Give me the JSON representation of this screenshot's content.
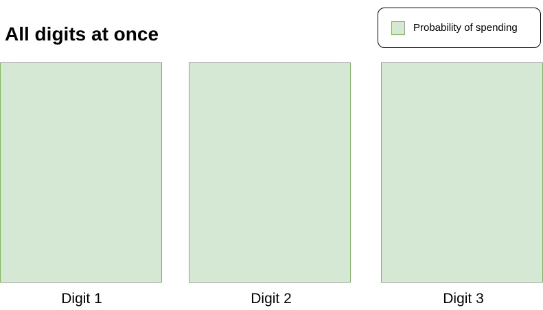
{
  "title": "All digits at once",
  "legend": {
    "label": "Probability of spending",
    "color": "#d5e8d4",
    "border_color": "#82b366"
  },
  "digits": [
    {
      "label": "Digit 1"
    },
    {
      "label": "Digit 2"
    },
    {
      "label": "Digit 3"
    }
  ],
  "colors": {
    "box_fill": "#d5e8d4",
    "box_border": "#82b366"
  }
}
